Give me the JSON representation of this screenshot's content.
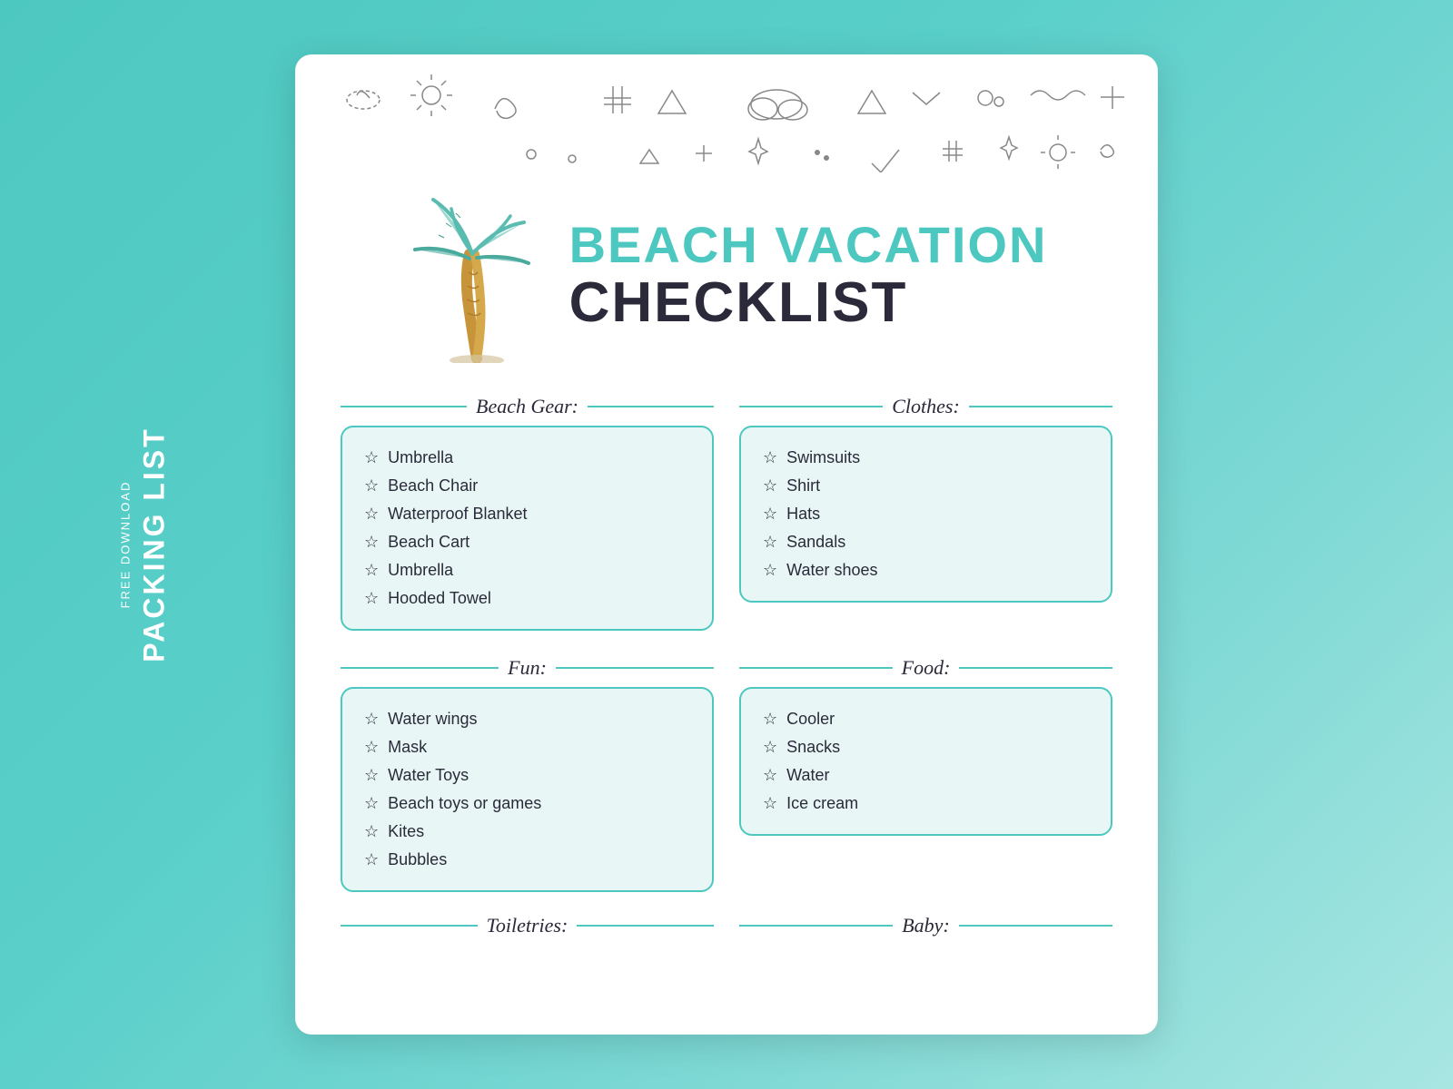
{
  "sidebar": {
    "free_download": "FREE DOWNLOAD",
    "packing_list": "PACKING LIST"
  },
  "header": {
    "line1": "BEACH VACATION",
    "line2": "CHECKLIST"
  },
  "sections": [
    {
      "id": "beach-gear",
      "title": "Beach Gear:",
      "items": [
        "Umbrella",
        "Beach Chair",
        "Waterproof Blanket",
        "Beach Cart",
        "Umbrella",
        "Hooded Towel"
      ]
    },
    {
      "id": "clothes",
      "title": "Clothes:",
      "items": [
        "Swimsuits",
        "Shirt",
        "Hats",
        "Sandals",
        "Water shoes"
      ]
    },
    {
      "id": "fun",
      "title": "Fun:",
      "items": [
        "Water wings",
        "Mask",
        "Water Toys",
        "Beach toys or games",
        "Kites",
        "Bubbles"
      ]
    },
    {
      "id": "food",
      "title": "Food:",
      "items": [
        "Cooler",
        "Snacks",
        "Water",
        "Ice cream"
      ]
    }
  ],
  "bottom_sections": [
    {
      "title": "Toiletries:"
    },
    {
      "title": "Baby:"
    }
  ],
  "accent_color": "#4cc8c0",
  "bg_color": "#5acfca"
}
